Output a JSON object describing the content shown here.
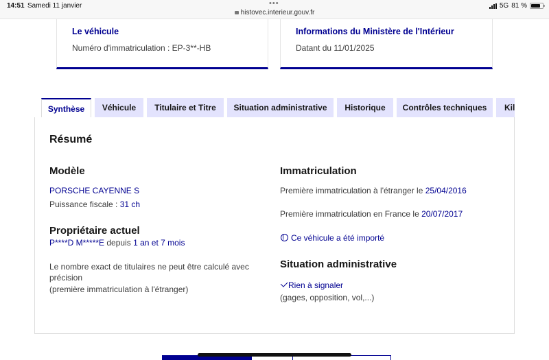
{
  "status": {
    "time": "14:51",
    "date": "Samedi 11 janvier",
    "url": "histovec.interieur.gouv.fr",
    "network": "5G",
    "battery": "81 %",
    "battery_level": 0.81
  },
  "cards": [
    {
      "title": "Le véhicule",
      "text": "Numéro d'immatriculation : EP-3**-HB"
    },
    {
      "title": "Informations du Ministère de l'Intérieur",
      "text": "Datant du 11/01/2025"
    }
  ],
  "tabs": [
    {
      "label": "Synthèse",
      "active": true
    },
    {
      "label": "Véhicule"
    },
    {
      "label": "Titulaire et Titre"
    },
    {
      "label": "Situation administrative"
    },
    {
      "label": "Historique"
    },
    {
      "label": "Contrôles techniques"
    },
    {
      "label": "Kil"
    }
  ],
  "summary": {
    "title": "Résumé",
    "model": {
      "heading": "Modèle",
      "name": "PORSCHE CAYENNE S",
      "power_label": "Puissance fiscale : ",
      "power_value": "31 ch"
    },
    "owner": {
      "heading": "Propriétaire actuel",
      "name": "P****D M*****E",
      "since_label": " depuis ",
      "since_value": "1 an et 7 mois",
      "note_line1": "Le nombre exact de titulaires ne peut être calculé avec précision",
      "note_line2": "(première immatriculation à l'étranger)"
    },
    "registration": {
      "heading": "Immatriculation",
      "foreign_label": "Première immatriculation à l'étranger le ",
      "foreign_date": "25/04/2016",
      "france_label": "Première immatriculation en France le ",
      "france_date": "20/07/2017",
      "imported": "Ce véhicule a été importé"
    },
    "admin": {
      "heading": "Situation administrative",
      "status": "Rien à signaler",
      "details": "(gages, opposition, vol,...)"
    }
  }
}
